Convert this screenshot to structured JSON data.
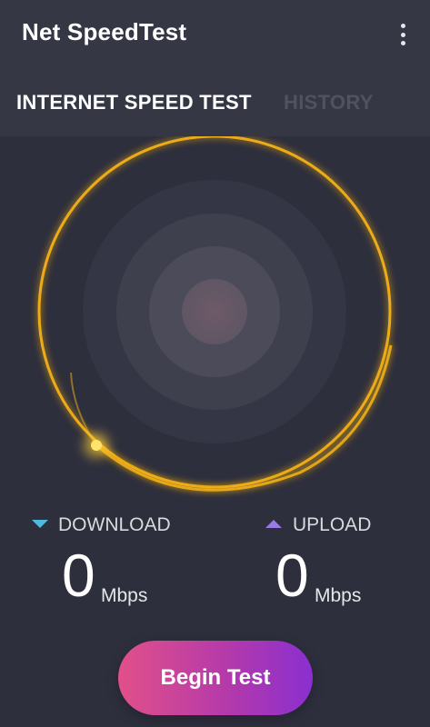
{
  "header": {
    "title": "Net SpeedTest",
    "menu_icon": "more-vert-icon"
  },
  "tabs": [
    {
      "label": "INTERNET SPEED TEST",
      "active": true
    },
    {
      "label": "HISTORY",
      "active": false
    }
  ],
  "gauge": {
    "ring_color": "#f7b218",
    "dot_color": "#ffd94a"
  },
  "download": {
    "label": "DOWNLOAD",
    "value": "0",
    "unit": "Mbps",
    "icon": "triangle-down-icon",
    "color": "#4fb9df"
  },
  "upload": {
    "label": "UPLOAD",
    "value": "0",
    "unit": "Mbps",
    "icon": "triangle-up-icon",
    "color": "#9a7ae6"
  },
  "action": {
    "begin_label": "Begin Test"
  }
}
